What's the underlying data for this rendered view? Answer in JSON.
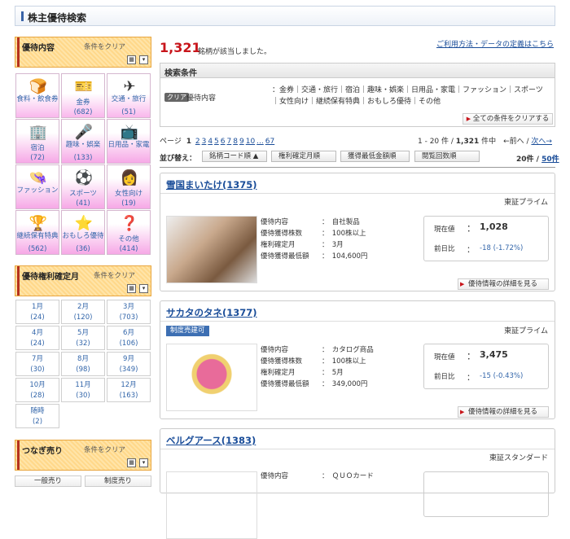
{
  "header": {
    "title": "株主優待検索"
  },
  "panel_content": {
    "title": "優待内容",
    "clear": "条件をクリア",
    "categories": [
      {
        "label": "食料・飲食券",
        "count": "",
        "icon": "🍞"
      },
      {
        "label": "金券",
        "count": "(682)",
        "icon": "🎫"
      },
      {
        "label": "交通・旅行",
        "count": "(51)",
        "icon": "✈"
      },
      {
        "label": "宿泊",
        "count": "(72)",
        "icon": "🏢"
      },
      {
        "label": "趣味・娯楽",
        "count": "(133)",
        "icon": "🎤"
      },
      {
        "label": "日用品・家電",
        "count": "",
        "icon": "📺"
      },
      {
        "label": "ファッション",
        "count": "",
        "icon": "👒"
      },
      {
        "label": "スポーツ",
        "count": "(41)",
        "icon": "⚽"
      },
      {
        "label": "女性向け",
        "count": "(19)",
        "icon": "👩"
      },
      {
        "label": "継続保有特典",
        "count": "(562)",
        "icon": "🏆"
      },
      {
        "label": "おもしろ優待",
        "count": "(36)",
        "icon": "⭐"
      },
      {
        "label": "その他",
        "count": "(414)",
        "icon": "❓"
      }
    ]
  },
  "panel_month": {
    "title": "優待権利確定月",
    "clear": "条件をクリア",
    "months": [
      {
        "m": "1月",
        "c": "(24)"
      },
      {
        "m": "2月",
        "c": "(120)"
      },
      {
        "m": "3月",
        "c": "(703)"
      },
      {
        "m": "4月",
        "c": "(24)"
      },
      {
        "m": "5月",
        "c": "(32)"
      },
      {
        "m": "6月",
        "c": "(106)"
      },
      {
        "m": "7月",
        "c": "(30)"
      },
      {
        "m": "8月",
        "c": "(98)"
      },
      {
        "m": "9月",
        "c": "(349)"
      },
      {
        "m": "10月",
        "c": "(28)"
      },
      {
        "m": "11月",
        "c": "(30)"
      },
      {
        "m": "12月",
        "c": "(163)"
      },
      {
        "m": "随時",
        "c": "(2)"
      }
    ]
  },
  "panel_short": {
    "title": "つなぎ売り",
    "clear": "条件をクリア",
    "btn1": "一般売り",
    "btn2": "制度売り"
  },
  "result": {
    "count": "1,321",
    "text": "銘柄が該当しました。",
    "help": "ご利用方法・データの定義はこちら"
  },
  "conditions": {
    "title": "検索条件",
    "badge": "クリア",
    "label": "優待内容",
    "values": "：金券｜交通・旅行｜宿泊｜趣味・娯楽｜日用品・家電｜ファッション｜スポーツ｜女性向け｜継続保有特典｜おもしろ優待｜その他",
    "clear_all": "全ての条件をクリアする"
  },
  "pager": {
    "label": "ページ",
    "current": "1",
    "pages": [
      "2",
      "3",
      "4",
      "5",
      "6",
      "7",
      "8",
      "9",
      "10",
      "...",
      "67"
    ],
    "info_a": "1 - 20 件 / ",
    "info_total": "1,321",
    "info_b": " 件中　←前へ /",
    "next": "次へ→"
  },
  "sort": {
    "label": "並び替え：",
    "buttons": [
      "銘柄コード順 ▲",
      "権利確定月順",
      "獲得最低金額順",
      "閲覧回数順"
    ],
    "per_a": "20件 / ",
    "per_b": "50件"
  },
  "cards": [
    {
      "name": "雪国まいたけ(1375)",
      "market": "東証プライム",
      "tag": "",
      "labels": [
        "優待内容",
        "優待獲得株数",
        "権利確定月",
        "優待獲得最低額"
      ],
      "values": [
        "：　自社製品",
        "：　100株以上",
        "：　3月",
        "：　104,600円"
      ],
      "price_label": "現在値",
      "price": "1,028",
      "chg_label": "前日比",
      "chg": "-18 (-1.72%)",
      "detail": "優待情報の詳細を見る"
    },
    {
      "name": "サカタのタネ(1377)",
      "market": "東証プライム",
      "tag": "制度売建可",
      "labels": [
        "優待内容",
        "優待獲得株数",
        "権利確定月",
        "優待獲得最低額"
      ],
      "values": [
        "：　カタログ商品",
        "：　100株以上",
        "：　5月",
        "：　349,000円"
      ],
      "price_label": "現在値",
      "price": "3,475",
      "chg_label": "前日比",
      "chg": "-15 (-0.43%)",
      "detail": "優待情報の詳細を見る"
    },
    {
      "name": "ベルグアース(1383)",
      "market": "東証スタンダード",
      "tag": "",
      "labels": [
        "優待内容"
      ],
      "values": [
        "：　ＱＵＯカード"
      ]
    }
  ]
}
